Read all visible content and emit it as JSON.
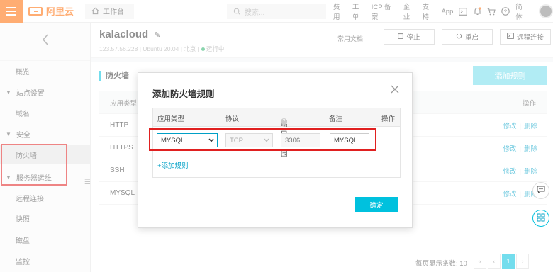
{
  "topbar": {
    "logo_text": "阿里云",
    "workbench_label": "工作台",
    "search_placeholder": "搜索...",
    "links": [
      "费用",
      "工单",
      "ICP 备案",
      "企业",
      "支持",
      "App"
    ],
    "language_label": "简体"
  },
  "sidebar": {
    "back_icon": "chevron-left-icon",
    "items": [
      {
        "label": "概览",
        "type": "sub"
      },
      {
        "label": "站点设置",
        "type": "group"
      },
      {
        "label": "域名",
        "type": "sub"
      },
      {
        "label": "安全",
        "type": "group"
      },
      {
        "label": "防火墙",
        "type": "sub",
        "active": true
      },
      {
        "label": "服务器运维",
        "type": "group"
      },
      {
        "label": "远程连接",
        "type": "sub"
      },
      {
        "label": "快照",
        "type": "sub"
      },
      {
        "label": "磁盘",
        "type": "sub"
      },
      {
        "label": "监控",
        "type": "sub"
      }
    ]
  },
  "instance": {
    "name": "kalacloud",
    "meta": "123.57.56.228 | Ubuntu 20.04 | 北京 |",
    "status": "运行中",
    "docs_label": "常用文档",
    "stop_label": "停止",
    "restart_label": "重启",
    "remote_label": "远程连接"
  },
  "firewall": {
    "title": "防火墙",
    "add_button": "添加规则",
    "col_type": "应用类型",
    "col_ops": "操作",
    "rows": [
      "HTTP",
      "HTTPS",
      "SSH",
      "MYSQL"
    ],
    "op_edit": "修改",
    "op_delete": "删除",
    "pager_label": "每页显示条数: 10",
    "pager": [
      "«",
      "‹",
      "1",
      "›"
    ]
  },
  "modal": {
    "title": "添加防火墙规则",
    "headers": {
      "type": "应用类型",
      "protocol": "协议",
      "port": "端口范围",
      "note": "备注",
      "ops": "操作"
    },
    "row": {
      "type_value": "MYSQL",
      "protocol_value": "TCP",
      "port_value": "3306",
      "note_value": "MYSQL"
    },
    "add_link": "+添加规则",
    "confirm": "确定"
  },
  "colors": {
    "brand": "#ff6a00",
    "accent": "#00c1de",
    "link": "#00a0c6",
    "highlight": "#e02020",
    "status_ok": "#2ab16b"
  }
}
